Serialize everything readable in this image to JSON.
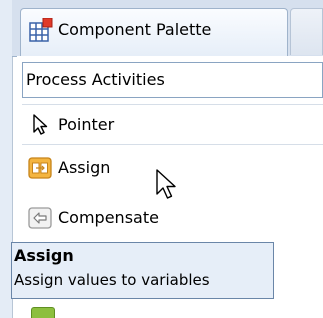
{
  "panel": {
    "tab_title": "Component Palette",
    "tab_icon": "component-palette-icon"
  },
  "category": {
    "selected": "Process Activities"
  },
  "items": [
    {
      "label": "Pointer",
      "icon": "pointer-arrow-icon"
    },
    {
      "label": "Assign",
      "icon": "assign-icon"
    },
    {
      "label": "Compensate",
      "icon": "compensate-icon"
    }
  ],
  "tooltip": {
    "title": "Assign",
    "description": "Assign values to variables"
  },
  "colors": {
    "tab_background": "#d6e0ee",
    "tooltip_background": "#e6eef8",
    "tooltip_border": "#6a86a8",
    "assign_icon": "#f4b540"
  }
}
